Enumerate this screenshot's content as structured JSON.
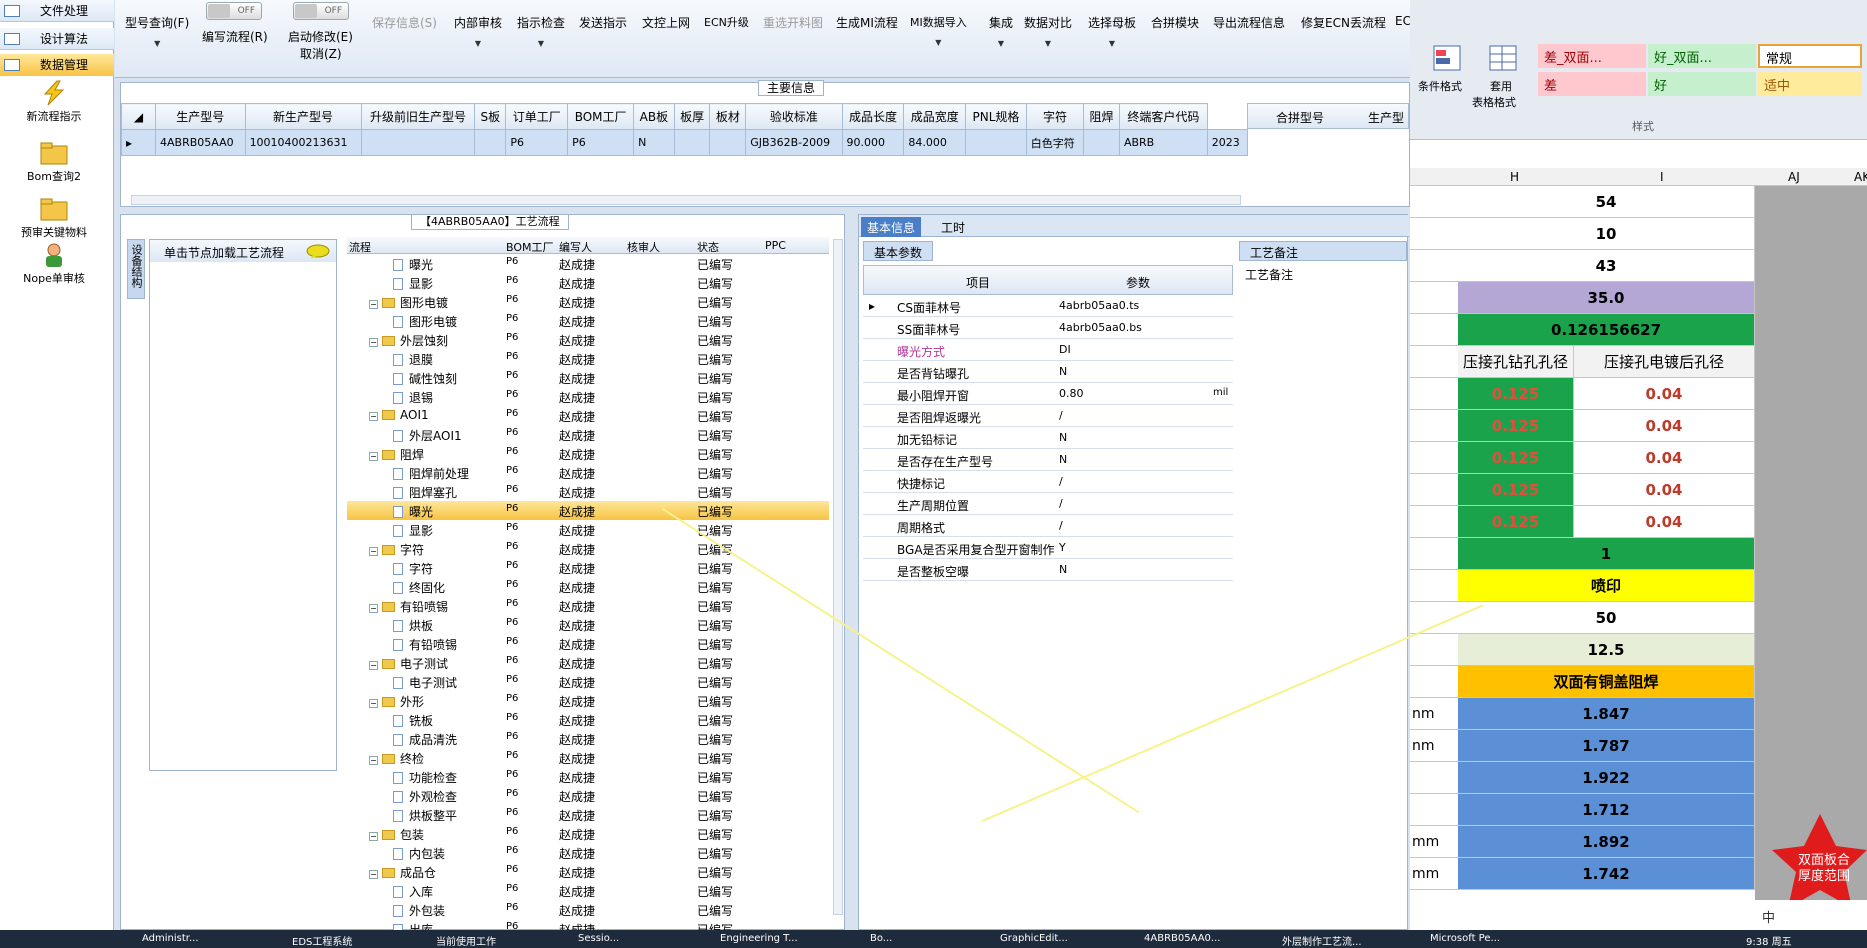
{
  "nav": {
    "rows": [
      "文件处理",
      "设计算法",
      "数据管理"
    ],
    "links": [
      "新流程指示",
      "Bom查询2",
      "预审关键物料",
      "Nope单审核"
    ]
  },
  "toolbar": {
    "items": [
      "型号查询(F)",
      "编写流程(R)",
      "启动修改(E)",
      "取消(Z)",
      "保存信息(S)",
      "内部审核",
      "指示检查",
      "发送指示",
      "文控上网",
      "ECN升级",
      "重选开料图",
      "生成MI流程",
      "MI数据导入",
      "集成",
      "数据对比",
      "选择母板",
      "合拼模块",
      "导出流程信息",
      "修复ECN丢流程",
      "EC"
    ],
    "toggle_off": "OFF"
  },
  "main": {
    "title": "主要信息",
    "columns": [
      "生产型号",
      "新生产型号",
      "升级前旧生产型号",
      "S板",
      "订单工厂",
      "BOM工厂",
      "AB板",
      "板厚",
      "板材",
      "验收标准",
      "成品长度",
      "成品宽度",
      "PNL规格",
      "字符",
      "阻焊",
      "终端客户代码"
    ],
    "row": [
      "4ABRB05AA0",
      "10010400213631",
      "",
      "",
      "P6",
      "P6",
      "N",
      "",
      "",
      "GJB362B-2009",
      "90.000",
      "84.000",
      "",
      "白色字符",
      "",
      "ABRB"
    ],
    "row_extra": "2023",
    "right_columns": [
      "合拼型号",
      "生产型"
    ]
  },
  "process": {
    "title": "【4ABRB05AA0】工艺流程",
    "side_tab": "设备结构",
    "hint": "单击节点加载工艺流程",
    "columns": [
      "流程",
      "BOM工厂",
      "编写人",
      "核审人",
      "状态",
      "PPC"
    ],
    "rows": [
      {
        "lvl": 2,
        "name": "曝光",
        "bom": "P6",
        "who": "赵成捷",
        "st": "已编写"
      },
      {
        "lvl": 2,
        "name": "显影",
        "bom": "P6",
        "who": "赵成捷",
        "st": "已编写"
      },
      {
        "lvl": 1,
        "name": "图形电镀",
        "bom": "P6",
        "who": "赵成捷",
        "st": "已编写"
      },
      {
        "lvl": 2,
        "name": "图形电镀",
        "bom": "P6",
        "who": "赵成捷",
        "st": "已编写"
      },
      {
        "lvl": 1,
        "name": "外层蚀刻",
        "bom": "P6",
        "who": "赵成捷",
        "st": "已编写"
      },
      {
        "lvl": 2,
        "name": "退膜",
        "bom": "P6",
        "who": "赵成捷",
        "st": "已编写"
      },
      {
        "lvl": 2,
        "name": "碱性蚀刻",
        "bom": "P6",
        "who": "赵成捷",
        "st": "已编写"
      },
      {
        "lvl": 2,
        "name": "退锡",
        "bom": "P6",
        "who": "赵成捷",
        "st": "已编写"
      },
      {
        "lvl": 1,
        "name": "AOI1",
        "bom": "P6",
        "who": "赵成捷",
        "st": "已编写"
      },
      {
        "lvl": 2,
        "name": "外层AOI1",
        "bom": "P6",
        "who": "赵成捷",
        "st": "已编写"
      },
      {
        "lvl": 1,
        "name": "阻焊",
        "bom": "P6",
        "who": "赵成捷",
        "st": "已编写"
      },
      {
        "lvl": 2,
        "name": "阻焊前处理",
        "bom": "P6",
        "who": "赵成捷",
        "st": "已编写"
      },
      {
        "lvl": 2,
        "name": "阻焊塞孔",
        "bom": "P6",
        "who": "赵成捷",
        "st": "已编写"
      },
      {
        "lvl": 2,
        "name": "曝光",
        "bom": "P6",
        "who": "赵成捷",
        "st": "已编写",
        "sel": true
      },
      {
        "lvl": 2,
        "name": "显影",
        "bom": "P6",
        "who": "赵成捷",
        "st": "已编写"
      },
      {
        "lvl": 1,
        "name": "字符",
        "bom": "P6",
        "who": "赵成捷",
        "st": "已编写"
      },
      {
        "lvl": 2,
        "name": "字符",
        "bom": "P6",
        "who": "赵成捷",
        "st": "已编写"
      },
      {
        "lvl": 2,
        "name": "终固化",
        "bom": "P6",
        "who": "赵成捷",
        "st": "已编写"
      },
      {
        "lvl": 1,
        "name": "有铅喷锡",
        "bom": "P6",
        "who": "赵成捷",
        "st": "已编写"
      },
      {
        "lvl": 2,
        "name": "烘板",
        "bom": "P6",
        "who": "赵成捷",
        "st": "已编写"
      },
      {
        "lvl": 2,
        "name": "有铅喷锡",
        "bom": "P6",
        "who": "赵成捷",
        "st": "已编写"
      },
      {
        "lvl": 1,
        "name": "电子测试",
        "bom": "P6",
        "who": "赵成捷",
        "st": "已编写"
      },
      {
        "lvl": 2,
        "name": "电子测试",
        "bom": "P6",
        "who": "赵成捷",
        "st": "已编写"
      },
      {
        "lvl": 1,
        "name": "外形",
        "bom": "P6",
        "who": "赵成捷",
        "st": "已编写"
      },
      {
        "lvl": 2,
        "name": "铣板",
        "bom": "P6",
        "who": "赵成捷",
        "st": "已编写"
      },
      {
        "lvl": 2,
        "name": "成品清洗",
        "bom": "P6",
        "who": "赵成捷",
        "st": "已编写"
      },
      {
        "lvl": 1,
        "name": "终检",
        "bom": "P6",
        "who": "赵成捷",
        "st": "已编写"
      },
      {
        "lvl": 2,
        "name": "功能检查",
        "bom": "P6",
        "who": "赵成捷",
        "st": "已编写"
      },
      {
        "lvl": 2,
        "name": "外观检查",
        "bom": "P6",
        "who": "赵成捷",
        "st": "已编写"
      },
      {
        "lvl": 2,
        "name": "烘板整平",
        "bom": "P6",
        "who": "赵成捷",
        "st": "已编写"
      },
      {
        "lvl": 1,
        "name": "包装",
        "bom": "P6",
        "who": "赵成捷",
        "st": "已编写"
      },
      {
        "lvl": 2,
        "name": "内包装",
        "bom": "P6",
        "who": "赵成捷",
        "st": "已编写"
      },
      {
        "lvl": 1,
        "name": "成品仓",
        "bom": "P6",
        "who": "赵成捷",
        "st": "已编写"
      },
      {
        "lvl": 2,
        "name": "入库",
        "bom": "P6",
        "who": "赵成捷",
        "st": "已编写"
      },
      {
        "lvl": 2,
        "name": "外包装",
        "bom": "P6",
        "who": "赵成捷",
        "st": "已编写"
      },
      {
        "lvl": 2,
        "name": "出库",
        "bom": "P6",
        "who": "赵成捷",
        "st": "已编写"
      }
    ]
  },
  "info": {
    "tabs": [
      "基本信息",
      "工时"
    ],
    "sub_tab": "基本参数",
    "notes_tab": "工艺备注",
    "notes_label": "工艺备注",
    "columns": [
      "项目",
      "参数"
    ],
    "rows": [
      {
        "k": "CS面菲林号",
        "v": "4abrb05aa0.ts"
      },
      {
        "k": "SS面菲林号",
        "v": "4abrb05aa0.bs"
      },
      {
        "k": "曝光方式",
        "v": "DI",
        "hl": true
      },
      {
        "k": "是否背钻曝孔",
        "v": "N"
      },
      {
        "k": "最小阻焊开窗",
        "v": "0.80",
        "u": "mil"
      },
      {
        "k": "是否阻焊返曝光",
        "v": "/"
      },
      {
        "k": "加无铅标记",
        "v": "N"
      },
      {
        "k": "是否存在生产型号",
        "v": "N"
      },
      {
        "k": "快捷标记",
        "v": "/"
      },
      {
        "k": "生产周期位置",
        "v": "/"
      },
      {
        "k": "周期格式",
        "v": "/"
      },
      {
        "k": "BGA是否采用复合型开窗制作",
        "v": "Y"
      },
      {
        "k": "是否整板空曝",
        "v": "N"
      }
    ]
  },
  "excel": {
    "styles": {
      "bad": "差_双面...",
      "good": "好_双面...",
      "normal": "常规",
      "bad2": "差",
      "good2": "好",
      "neutral": "适中"
    },
    "ribbon": {
      "cond": "条件格式",
      "apply": "套用",
      "table": "表格格式",
      "group": "样式"
    },
    "cols": [
      "H",
      "I",
      "AJ",
      "AK"
    ],
    "rows": [
      {
        "h": "54"
      },
      {
        "h": "10"
      },
      {
        "h": "43"
      },
      {
        "h": "35.0",
        "bg": "#b4a7d6"
      },
      {
        "h": "0.126156627",
        "bg": "#1aa34a"
      },
      {
        "h": "压接孔钻孔孔径",
        "i": "压接孔电镀后孔径",
        "hdr": true
      },
      {
        "h": "0.125",
        "i": "0.04",
        "pair": true
      },
      {
        "h": "0.125",
        "i": "0.04",
        "pair": true
      },
      {
        "h": "0.125",
        "i": "0.04",
        "pair": true
      },
      {
        "h": "0.125",
        "i": "0.04",
        "pair": true
      },
      {
        "h": "0.125",
        "i": "0.04",
        "pair": true
      },
      {
        "h": "1",
        "bg": "#1aa34a"
      },
      {
        "h": "喷印",
        "bg": "#ffff00"
      },
      {
        "h": "50"
      },
      {
        "h": "12.5",
        "bg": "#e6eed8"
      },
      {
        "h": "双面有铜盖阻焊",
        "bg": "#ffc000"
      },
      {
        "h": "1.847",
        "bg": "#5b8fd6",
        "lbl": "nm"
      },
      {
        "h": "1.787",
        "bg": "#5b8fd6",
        "lbl": "nm"
      },
      {
        "h": "1.922",
        "bg": "#5b8fd6"
      },
      {
        "h": "1.712",
        "bg": "#5b8fd6"
      },
      {
        "h": "1.892",
        "bg": "#5b8fd6",
        "lbl": "mm"
      },
      {
        "h": "1.742",
        "bg": "#5b8fd6",
        "lbl": "mm"
      }
    ],
    "star_text": "双面板合\n厚度范围"
  },
  "taskbar": {
    "items": [
      "Administr...",
      "EDS工程系统",
      "当前使用工作",
      "Sessio...",
      "Engineering T...",
      "Bo...",
      "GraphicEdit...",
      "4ABRB05AA0...",
      "外层制作工艺流...",
      "Microsoft Pe..."
    ],
    "time": "9:38 周五",
    "ime": "中"
  }
}
